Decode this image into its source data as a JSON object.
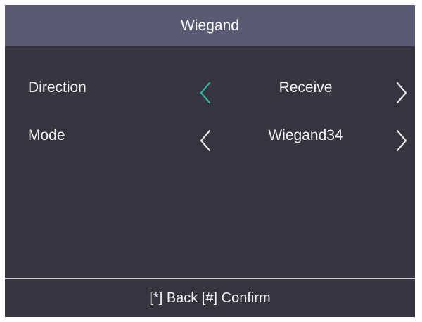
{
  "header": {
    "title": "Wiegand"
  },
  "settings": [
    {
      "label": "Direction",
      "value": "Receive",
      "focused": true
    },
    {
      "label": "Mode",
      "value": "Wiegand34",
      "focused": false
    }
  ],
  "footer": {
    "hint": "[*] Back [#] Confirm"
  },
  "colors": {
    "background": "#36353f",
    "header": "#5a5a73",
    "focus_arrow": "#2bb3a6",
    "arrow": "#e6e6e6",
    "text": "#f0f0f0"
  },
  "icons": {
    "prev": "chevron-left-icon",
    "next": "chevron-right-icon"
  }
}
